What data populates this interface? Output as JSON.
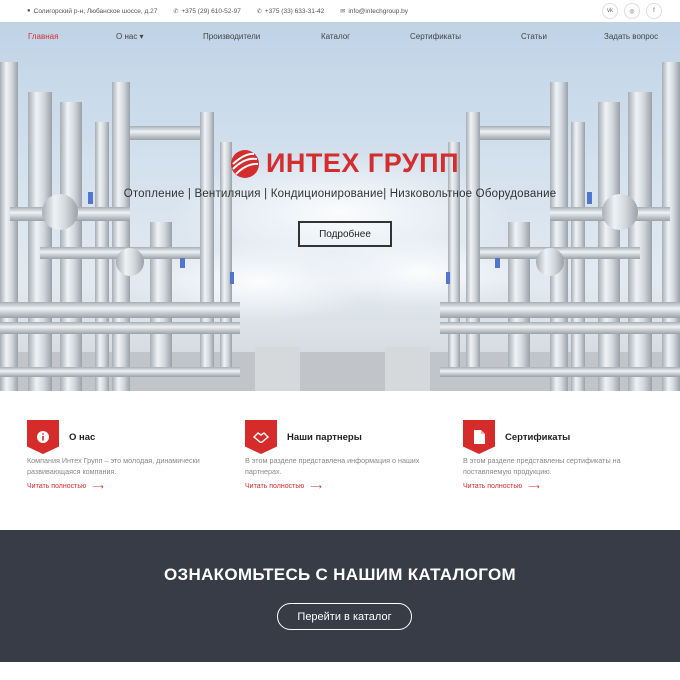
{
  "topbar": {
    "address": "Солигорский р-н, Любанское шоссе, д.27",
    "phone1": "+375 (29) 610-52-97",
    "phone2": "+375 (33) 633-31-42",
    "email": "info@intechgroup.by",
    "social": [
      {
        "icon": "vk-icon",
        "label": "vk"
      },
      {
        "icon": "instagram-icon",
        "label": "◎"
      },
      {
        "icon": "facebook-icon",
        "label": "f"
      }
    ]
  },
  "nav": {
    "items": [
      {
        "label": "Главная",
        "active": true
      },
      {
        "label": "О нас ▾",
        "active": false
      },
      {
        "label": "Производители",
        "active": false
      },
      {
        "label": "Каталог",
        "active": false
      },
      {
        "label": "Сертификаты",
        "active": false
      },
      {
        "label": "Статьи",
        "active": false
      },
      {
        "label": "Задать вопрос",
        "active": false
      }
    ]
  },
  "hero": {
    "brand": "ИНТЕХ ГРУПП",
    "tagline": "Отопление | Вентиляция | Кондиционирование| Низковольтное Оборудование",
    "button": "Подробнее"
  },
  "features": [
    {
      "icon": "info-icon",
      "title": "О нас",
      "text": "Компания Интех Групп – это молодая, динамически развивающаяся компания.",
      "link": "Читать полностью"
    },
    {
      "icon": "handshake-icon",
      "title": "Наши партнеры",
      "text": "В этом разделе представлена информация о наших партнерах.",
      "link": "Читать полностью"
    },
    {
      "icon": "document-icon",
      "title": "Сертификаты",
      "text": "В этом разделе представлены сертификаты на поставляемую продукцию.",
      "link": "Читать полностью"
    }
  ],
  "catalog": {
    "title": "ОЗНАКОМЬТЕСЬ С НАШИМ КАТАЛОГОМ",
    "button": "Перейти в каталог"
  },
  "colors": {
    "accent": "#d32d2d",
    "dark_band": "#383c47"
  }
}
